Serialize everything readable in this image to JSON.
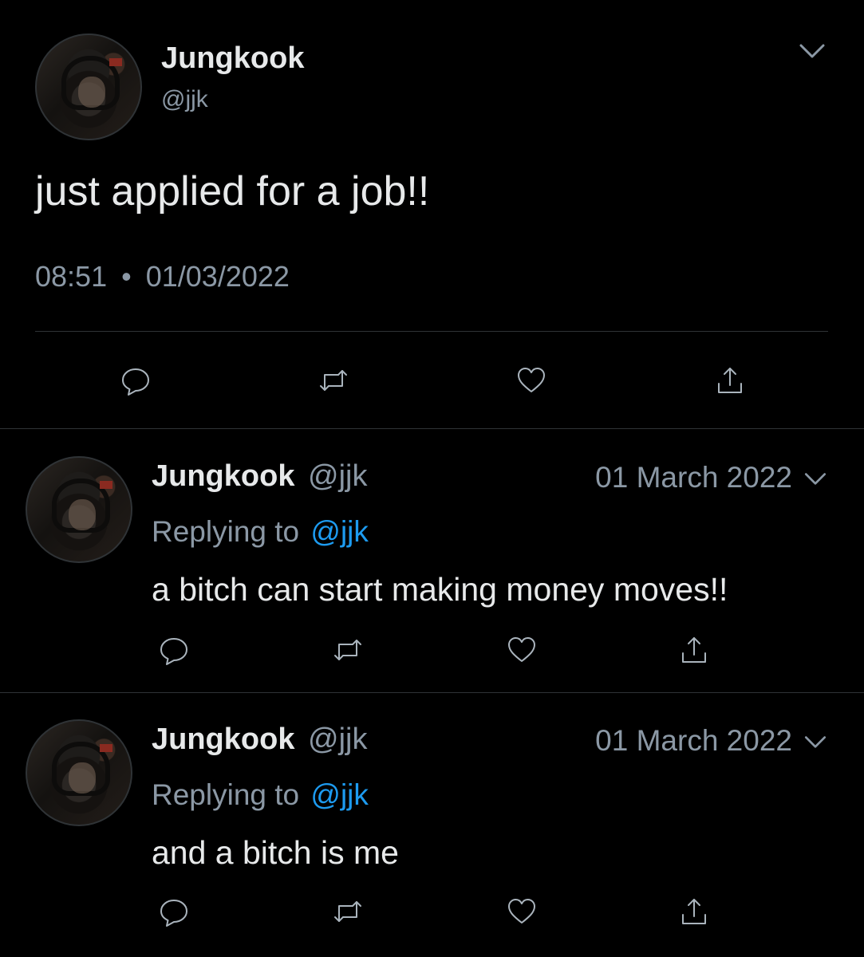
{
  "main_tweet": {
    "author_name": "Jungkook",
    "handle": "@jjk",
    "text": "just applied for a job!!",
    "time": "08:51",
    "separator": "•",
    "date": "01/03/2022"
  },
  "replies": [
    {
      "author_name": "Jungkook",
      "handle": "@jjk",
      "date": "01 March 2022",
      "replying_prefix": "Replying to",
      "replying_handle": "@jjk",
      "text": "a bitch can start making money moves!!"
    },
    {
      "author_name": "Jungkook",
      "handle": "@jjk",
      "date": "01 March 2022",
      "replying_prefix": "Replying to",
      "replying_handle": "@jjk",
      "text": "and a bitch is me"
    }
  ],
  "icons": {
    "reply": "reply-icon",
    "retweet": "retweet-icon",
    "like": "like-icon",
    "share": "share-icon",
    "menu": "chevron-down-icon"
  },
  "colors": {
    "background": "#000000",
    "text": "#e7e9ea",
    "muted": "#8b98a5",
    "link": "#1d9bf0",
    "divider": "#2f3336"
  }
}
